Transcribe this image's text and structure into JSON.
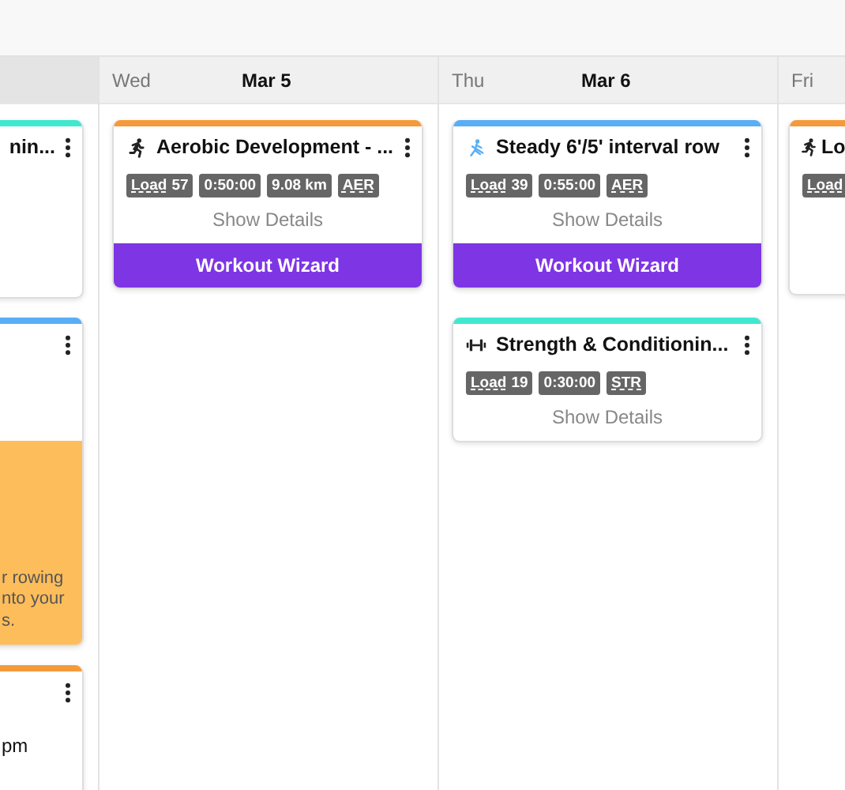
{
  "days": [
    {
      "cards": [
        {
          "color": "#40e8d0",
          "title": "nin..."
        },
        {
          "color": "#5aaef5",
          "notice_lines": [
            "r rowing",
            "nto your",
            "s."
          ]
        },
        {
          "color": "#f59a3c",
          "note": "pm"
        }
      ]
    },
    {
      "weekday": "Wed",
      "date": "Mar 5",
      "cards": [
        {
          "color": "#f59a3c",
          "kind": "run",
          "title": "Aerobic Development - ...",
          "badges": [
            {
              "kind": "load",
              "label": "Load",
              "value": "57"
            },
            {
              "kind": "plain",
              "label": "0:50:00"
            },
            {
              "kind": "plain",
              "label": "9.08 km"
            },
            {
              "kind": "type",
              "label": "AER"
            }
          ],
          "details": "Show Details",
          "button": "Workout Wizard"
        }
      ]
    },
    {
      "weekday": "Thu",
      "date": "Mar 6",
      "cards": [
        {
          "color": "#5aaef5",
          "kind": "row",
          "title": "Steady 6'/5' interval row",
          "badges": [
            {
              "kind": "load",
              "label": "Load",
              "value": "39"
            },
            {
              "kind": "plain",
              "label": "0:55:00"
            },
            {
              "kind": "type",
              "label": "AER"
            }
          ],
          "details": "Show Details",
          "button": "Workout Wizard"
        },
        {
          "color": "#40e8d0",
          "kind": "strength",
          "title": "Strength & Conditionin...",
          "badges": [
            {
              "kind": "load",
              "label": "Load",
              "value": "19"
            },
            {
              "kind": "plain",
              "label": "0:30:00"
            },
            {
              "kind": "type",
              "label": "STR"
            }
          ],
          "details": "Show Details"
        }
      ]
    },
    {
      "weekday": "Fri",
      "cards": [
        {
          "color": "#f59a3c",
          "kind": "run",
          "title": "Lo",
          "badges": [
            {
              "kind": "load",
              "label": "Load"
            }
          ]
        }
      ]
    }
  ]
}
